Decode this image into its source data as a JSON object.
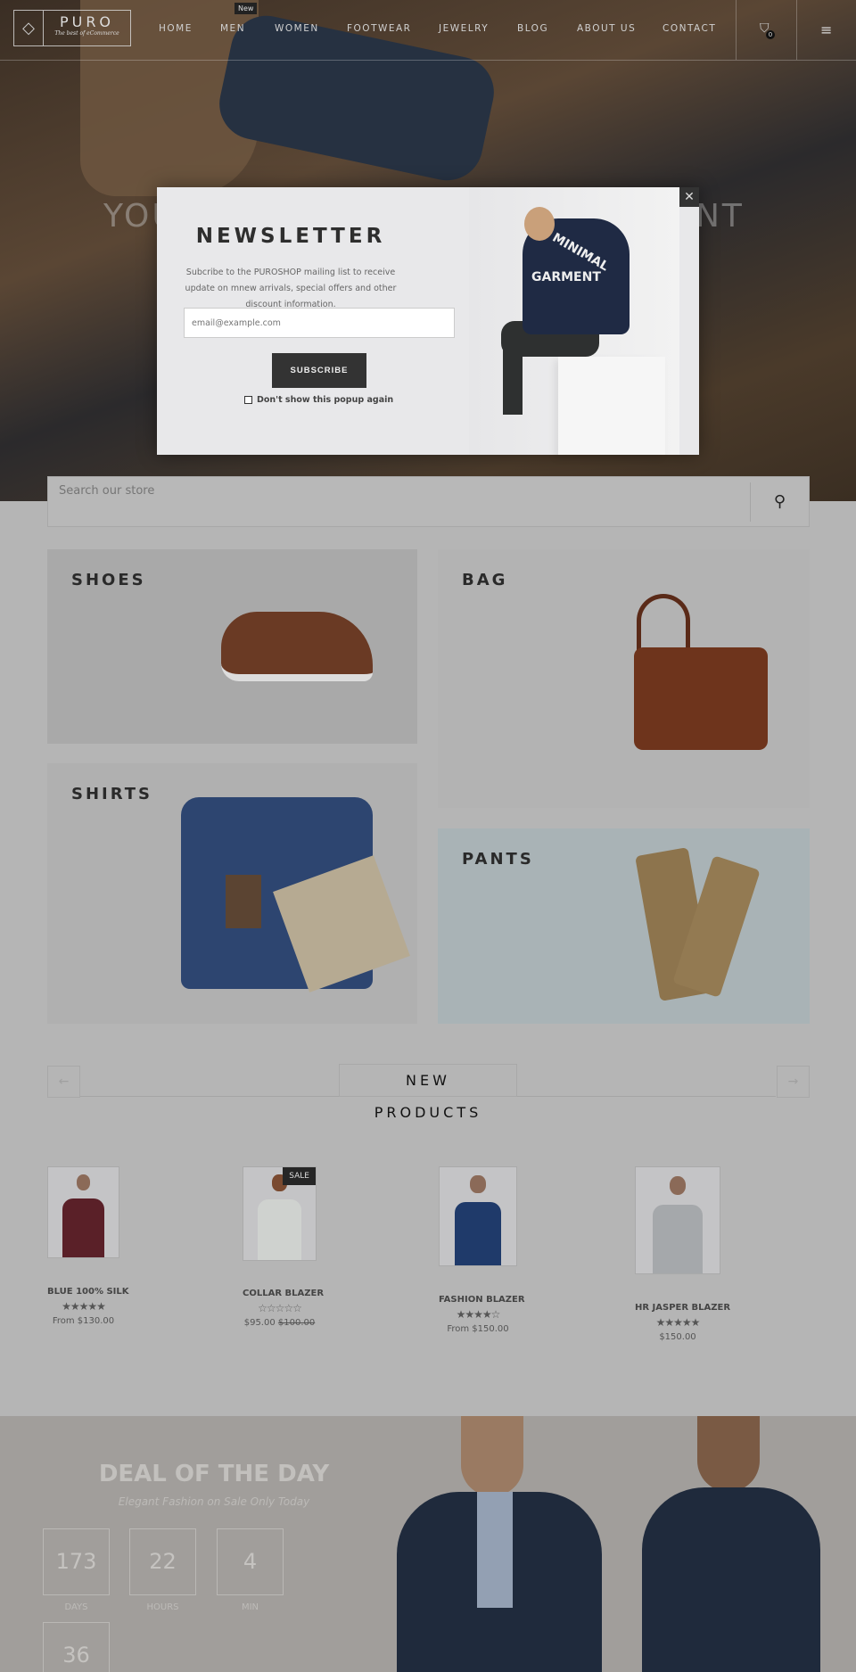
{
  "header": {
    "logo": {
      "name": "PURO",
      "tagline": "The best of eCommerce"
    },
    "nav": [
      "HOME",
      "MEN",
      "WOMEN",
      "FOOTWEAR",
      "JEWELRY",
      "BLOG",
      "ABOUT US",
      "CONTACT"
    ],
    "new_badge": "New",
    "cart_count": "0"
  },
  "hero": {
    "text_left": "YOU",
    "text_right": "NT"
  },
  "newsletter": {
    "title": "NEWSLETTER",
    "description": "Subcribe to the PUROSHOP mailing list to receive update on mnew arrivals, special offers and other discount information.",
    "email_placeholder": "email@example.com",
    "subscribe_label": "SUBSCRIBE",
    "dont_show_label": "Don't show this popup again",
    "image_text": [
      "MINIMAL",
      "GARMENT"
    ]
  },
  "search": {
    "placeholder": "Search our store"
  },
  "categories": [
    "SHOES",
    "BAG",
    "SHIRTS",
    "PANTS"
  ],
  "new_products": {
    "title_line1": "NEW",
    "title_line2": "PRODUCTS",
    "items": [
      {
        "title": "BLUE 100% SILK",
        "rating": 5,
        "stars": "★★★★★",
        "price": "From $130.00",
        "old_price": "",
        "sale": ""
      },
      {
        "title": "COLLAR BLAZER",
        "rating": 0,
        "stars": "☆☆☆☆☆",
        "price": "$95.00",
        "old_price": "$100.00",
        "sale": "SALE"
      },
      {
        "title": "FASHION BLAZER",
        "rating": 4,
        "stars": "★★★★☆",
        "price": "From $150.00",
        "old_price": "",
        "sale": ""
      },
      {
        "title": "HR JASPER BLAZER",
        "rating": 5,
        "stars": "★★★★★",
        "price": "$150.00",
        "old_price": "",
        "sale": ""
      }
    ]
  },
  "deal": {
    "title": "DEAL OF THE DAY",
    "subtitle": "Elegant Fashion on Sale Only Today",
    "countdown": [
      {
        "value": "173",
        "label": "DAYS"
      },
      {
        "value": "22",
        "label": "HOURS"
      },
      {
        "value": "4",
        "label": "MIN"
      },
      {
        "value": "36",
        "label": ""
      }
    ]
  },
  "colors": {
    "overlay_bg": "#b5b5b5",
    "button_dark": "#333333",
    "modal_bg": "#e8e8ea"
  }
}
